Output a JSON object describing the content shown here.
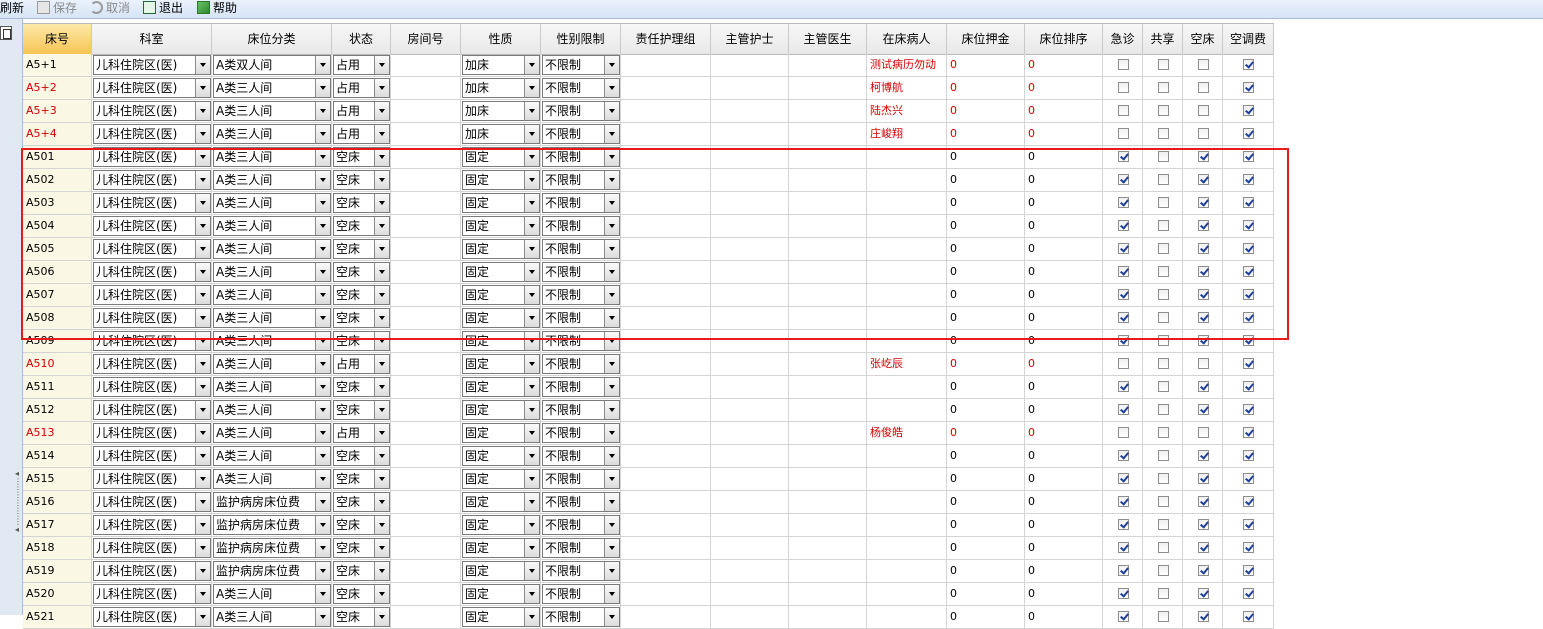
{
  "toolbar": {
    "refresh_label": "刷新",
    "save_label": "保存",
    "cancel_label": "取消",
    "exit_label": "退出",
    "help_label": "帮助"
  },
  "columns": [
    "床号",
    "科室",
    "床位分类",
    "状态",
    "房间号",
    "性质",
    "性别限制",
    "责任护理组",
    "主管护士",
    "主管医生",
    "在床病人",
    "床位押金",
    "床位排序",
    "急诊",
    "共享",
    "空床",
    "空调费"
  ],
  "rows": [
    {
      "bed": "A5+1",
      "dept": "儿科住院区(医)",
      "cat": "A类双人间",
      "status": "占用",
      "room": "",
      "nature": "加床",
      "gender": "不限制",
      "patient": "测试病历勿动",
      "deposit": "0",
      "order": "0",
      "emerg": false,
      "share": false,
      "empty": false,
      "ac": true,
      "red": false,
      "redvals": true
    },
    {
      "bed": "A5+2",
      "dept": "儿科住院区(医)",
      "cat": "A类三人间",
      "status": "占用",
      "room": "",
      "nature": "加床",
      "gender": "不限制",
      "patient": "柯博航",
      "deposit": "0",
      "order": "0",
      "emerg": false,
      "share": false,
      "empty": false,
      "ac": true,
      "red": true,
      "redvals": true
    },
    {
      "bed": "A5+3",
      "dept": "儿科住院区(医)",
      "cat": "A类三人间",
      "status": "占用",
      "room": "",
      "nature": "加床",
      "gender": "不限制",
      "patient": "陆杰兴",
      "deposit": "0",
      "order": "0",
      "emerg": false,
      "share": false,
      "empty": false,
      "ac": true,
      "red": true,
      "redvals": true
    },
    {
      "bed": "A5+4",
      "dept": "儿科住院区(医)",
      "cat": "A类三人间",
      "status": "占用",
      "room": "",
      "nature": "加床",
      "gender": "不限制",
      "patient": "庄峻翔",
      "deposit": "0",
      "order": "0",
      "emerg": false,
      "share": false,
      "empty": false,
      "ac": true,
      "red": true,
      "redvals": true
    },
    {
      "bed": "A501",
      "dept": "儿科住院区(医)",
      "cat": "A类三人间",
      "status": "空床",
      "room": "",
      "nature": "固定",
      "gender": "不限制",
      "patient": "",
      "deposit": "0",
      "order": "0",
      "emerg": true,
      "share": false,
      "empty": true,
      "ac": true,
      "red": false,
      "redvals": false
    },
    {
      "bed": "A502",
      "dept": "儿科住院区(医)",
      "cat": "A类三人间",
      "status": "空床",
      "room": "",
      "nature": "固定",
      "gender": "不限制",
      "patient": "",
      "deposit": "0",
      "order": "0",
      "emerg": true,
      "share": false,
      "empty": true,
      "ac": true,
      "red": false,
      "redvals": false
    },
    {
      "bed": "A503",
      "dept": "儿科住院区(医)",
      "cat": "A类三人间",
      "status": "空床",
      "room": "",
      "nature": "固定",
      "gender": "不限制",
      "patient": "",
      "deposit": "0",
      "order": "0",
      "emerg": true,
      "share": false,
      "empty": true,
      "ac": true,
      "red": false,
      "redvals": false
    },
    {
      "bed": "A504",
      "dept": "儿科住院区(医)",
      "cat": "A类三人间",
      "status": "空床",
      "room": "",
      "nature": "固定",
      "gender": "不限制",
      "patient": "",
      "deposit": "0",
      "order": "0",
      "emerg": true,
      "share": false,
      "empty": true,
      "ac": true,
      "red": false,
      "redvals": false
    },
    {
      "bed": "A505",
      "dept": "儿科住院区(医)",
      "cat": "A类三人间",
      "status": "空床",
      "room": "",
      "nature": "固定",
      "gender": "不限制",
      "patient": "",
      "deposit": "0",
      "order": "0",
      "emerg": true,
      "share": false,
      "empty": true,
      "ac": true,
      "red": false,
      "redvals": false
    },
    {
      "bed": "A506",
      "dept": "儿科住院区(医)",
      "cat": "A类三人间",
      "status": "空床",
      "room": "",
      "nature": "固定",
      "gender": "不限制",
      "patient": "",
      "deposit": "0",
      "order": "0",
      "emerg": true,
      "share": false,
      "empty": true,
      "ac": true,
      "red": false,
      "redvals": false
    },
    {
      "bed": "A507",
      "dept": "儿科住院区(医)",
      "cat": "A类三人间",
      "status": "空床",
      "room": "",
      "nature": "固定",
      "gender": "不限制",
      "patient": "",
      "deposit": "0",
      "order": "0",
      "emerg": true,
      "share": false,
      "empty": true,
      "ac": true,
      "red": false,
      "redvals": false
    },
    {
      "bed": "A508",
      "dept": "儿科住院区(医)",
      "cat": "A类三人间",
      "status": "空床",
      "room": "",
      "nature": "固定",
      "gender": "不限制",
      "patient": "",
      "deposit": "0",
      "order": "0",
      "emerg": true,
      "share": false,
      "empty": true,
      "ac": true,
      "red": false,
      "redvals": false
    },
    {
      "bed": "A509",
      "dept": "儿科住院区(医)",
      "cat": "A类三人间",
      "status": "空床",
      "room": "",
      "nature": "固定",
      "gender": "不限制",
      "patient": "",
      "deposit": "0",
      "order": "0",
      "emerg": true,
      "share": false,
      "empty": true,
      "ac": true,
      "red": false,
      "redvals": false
    },
    {
      "bed": "A510",
      "dept": "儿科住院区(医)",
      "cat": "A类三人间",
      "status": "占用",
      "room": "",
      "nature": "固定",
      "gender": "不限制",
      "patient": "张屹辰",
      "deposit": "0",
      "order": "0",
      "emerg": false,
      "share": false,
      "empty": false,
      "ac": true,
      "red": true,
      "redvals": true
    },
    {
      "bed": "A511",
      "dept": "儿科住院区(医)",
      "cat": "A类三人间",
      "status": "空床",
      "room": "",
      "nature": "固定",
      "gender": "不限制",
      "patient": "",
      "deposit": "0",
      "order": "0",
      "emerg": true,
      "share": false,
      "empty": true,
      "ac": true,
      "red": false,
      "redvals": false
    },
    {
      "bed": "A512",
      "dept": "儿科住院区(医)",
      "cat": "A类三人间",
      "status": "空床",
      "room": "",
      "nature": "固定",
      "gender": "不限制",
      "patient": "",
      "deposit": "0",
      "order": "0",
      "emerg": true,
      "share": false,
      "empty": true,
      "ac": true,
      "red": false,
      "redvals": false
    },
    {
      "bed": "A513",
      "dept": "儿科住院区(医)",
      "cat": "A类三人间",
      "status": "占用",
      "room": "",
      "nature": "固定",
      "gender": "不限制",
      "patient": "杨俊皓",
      "deposit": "0",
      "order": "0",
      "emerg": false,
      "share": false,
      "empty": false,
      "ac": true,
      "red": true,
      "redvals": true
    },
    {
      "bed": "A514",
      "dept": "儿科住院区(医)",
      "cat": "A类三人间",
      "status": "空床",
      "room": "",
      "nature": "固定",
      "gender": "不限制",
      "patient": "",
      "deposit": "0",
      "order": "0",
      "emerg": true,
      "share": false,
      "empty": true,
      "ac": true,
      "red": false,
      "redvals": false
    },
    {
      "bed": "A515",
      "dept": "儿科住院区(医)",
      "cat": "A类三人间",
      "status": "空床",
      "room": "",
      "nature": "固定",
      "gender": "不限制",
      "patient": "",
      "deposit": "0",
      "order": "0",
      "emerg": true,
      "share": false,
      "empty": true,
      "ac": true,
      "red": false,
      "redvals": false
    },
    {
      "bed": "A516",
      "dept": "儿科住院区(医)",
      "cat": "监护病房床位费",
      "status": "空床",
      "room": "",
      "nature": "固定",
      "gender": "不限制",
      "patient": "",
      "deposit": "0",
      "order": "0",
      "emerg": true,
      "share": false,
      "empty": true,
      "ac": true,
      "red": false,
      "redvals": false
    },
    {
      "bed": "A517",
      "dept": "儿科住院区(医)",
      "cat": "监护病房床位费",
      "status": "空床",
      "room": "",
      "nature": "固定",
      "gender": "不限制",
      "patient": "",
      "deposit": "0",
      "order": "0",
      "emerg": true,
      "share": false,
      "empty": true,
      "ac": true,
      "red": false,
      "redvals": false
    },
    {
      "bed": "A518",
      "dept": "儿科住院区(医)",
      "cat": "监护病房床位费",
      "status": "空床",
      "room": "",
      "nature": "固定",
      "gender": "不限制",
      "patient": "",
      "deposit": "0",
      "order": "0",
      "emerg": true,
      "share": false,
      "empty": true,
      "ac": true,
      "red": false,
      "redvals": false
    },
    {
      "bed": "A519",
      "dept": "儿科住院区(医)",
      "cat": "监护病房床位费",
      "status": "空床",
      "room": "",
      "nature": "固定",
      "gender": "不限制",
      "patient": "",
      "deposit": "0",
      "order": "0",
      "emerg": true,
      "share": false,
      "empty": true,
      "ac": true,
      "red": false,
      "redvals": false
    },
    {
      "bed": "A520",
      "dept": "儿科住院区(医)",
      "cat": "A类三人间",
      "status": "空床",
      "room": "",
      "nature": "固定",
      "gender": "不限制",
      "patient": "",
      "deposit": "0",
      "order": "0",
      "emerg": true,
      "share": false,
      "empty": true,
      "ac": true,
      "red": false,
      "redvals": false
    },
    {
      "bed": "A521",
      "dept": "儿科住院区(医)",
      "cat": "A类三人间",
      "status": "空床",
      "room": "",
      "nature": "固定",
      "gender": "不限制",
      "patient": "",
      "deposit": "0",
      "order": "0",
      "emerg": true,
      "share": false,
      "empty": true,
      "ac": true,
      "red": false,
      "redvals": false
    }
  ]
}
